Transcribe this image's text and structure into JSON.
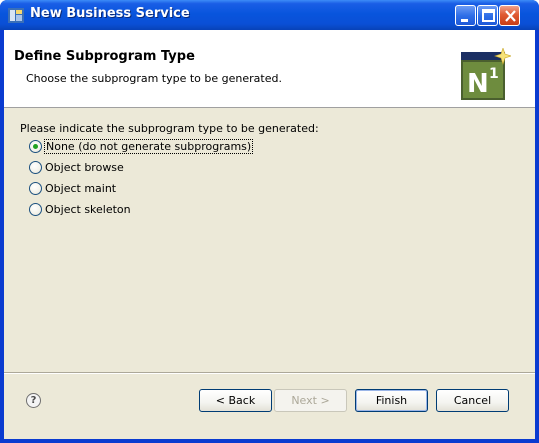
{
  "window": {
    "title": "New Business Service",
    "controls": [
      "minimize-icon",
      "maximize-icon",
      "close-icon"
    ]
  },
  "header": {
    "title": "Define Subprogram Type",
    "description": "Choose the subprogram type to be generated.",
    "logo_text": "N1"
  },
  "body": {
    "prompt": "Please indicate the subprogram type to be generated:",
    "options": [
      {
        "label": "None (do not generate subprograms)",
        "checked": true
      },
      {
        "label": "Object browse",
        "checked": false
      },
      {
        "label": "Object maint",
        "checked": false
      },
      {
        "label": "Object skeleton",
        "checked": false
      }
    ]
  },
  "footer": {
    "help_icon": "?",
    "back_label": "< Back",
    "next_label": "Next >",
    "finish_label": "Finish",
    "cancel_label": "Cancel"
  },
  "colors": {
    "titlebar": "#0a4fd6",
    "client_bg": "#ece9d8",
    "checked_dot": "#21a121"
  }
}
